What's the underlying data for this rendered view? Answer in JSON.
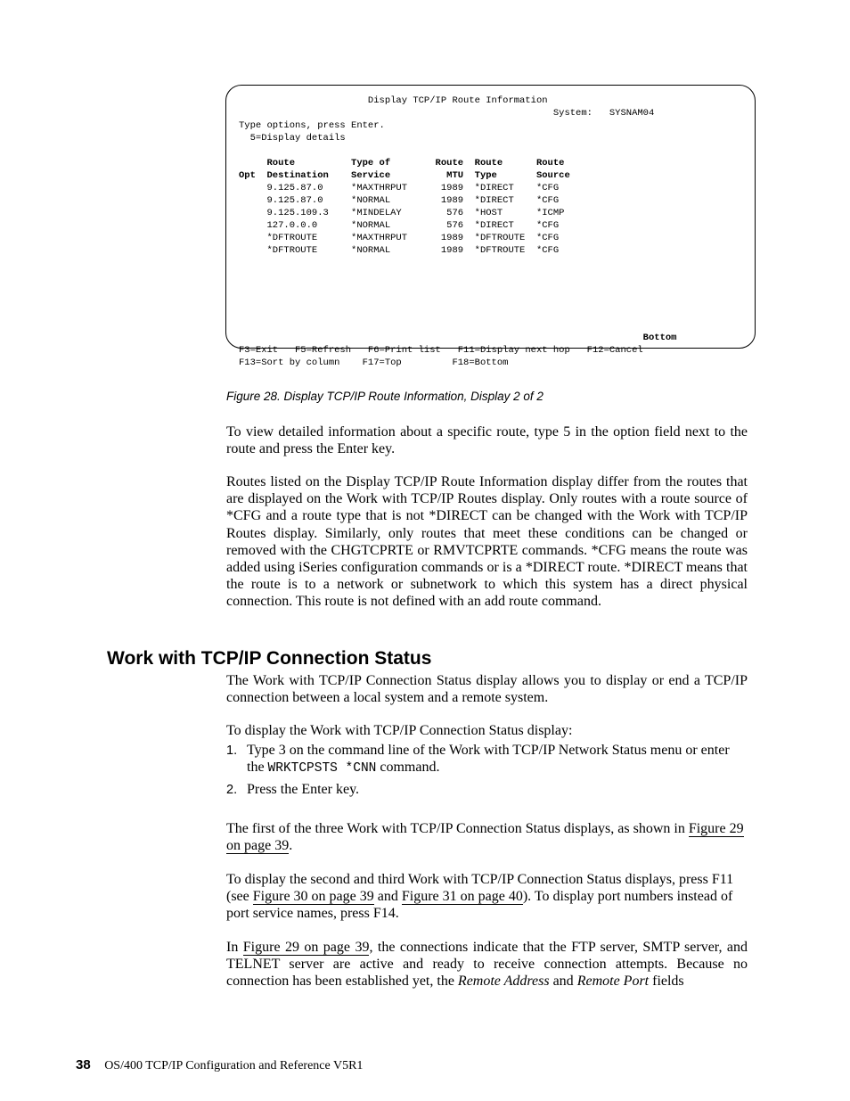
{
  "terminal": {
    "title": "Display TCP/IP Route Information",
    "system_label": "System:",
    "system_name": "SYSNAM04",
    "instruction1": "Type options, press Enter.",
    "instruction2": "  5=Display details",
    "headers": {
      "opt": "Opt",
      "route_dest1": "Route",
      "route_dest2": "Destination",
      "tos1": "Type of",
      "tos2": "Service",
      "mtu1": "Route",
      "mtu2": "MTU",
      "type1": "Route",
      "type2": "Type",
      "src1": "Route",
      "src2": "Source"
    },
    "rows": [
      {
        "dest": "9.125.87.0",
        "svc": "*MAXTHRPUT",
        "mtu": "1989",
        "type": "*DIRECT",
        "src": "*CFG"
      },
      {
        "dest": "9.125.87.0",
        "svc": "*NORMAL",
        "mtu": "1989",
        "type": "*DIRECT",
        "src": "*CFG"
      },
      {
        "dest": "9.125.109.3",
        "svc": "*MINDELAY",
        "mtu": "576",
        "type": "*HOST",
        "src": "*ICMP"
      },
      {
        "dest": "127.0.0.0",
        "svc": "*NORMAL",
        "mtu": "576",
        "type": "*DIRECT",
        "src": "*CFG"
      },
      {
        "dest": "*DFTROUTE",
        "svc": "*MAXTHRPUT",
        "mtu": "1989",
        "type": "*DFTROUTE",
        "src": "*CFG"
      },
      {
        "dest": "*DFTROUTE",
        "svc": "*NORMAL",
        "mtu": "1989",
        "type": "*DFTROUTE",
        "src": "*CFG"
      }
    ],
    "bottom_label": "Bottom",
    "fkeys_line1": "F3=Exit   F5=Refresh   F6=Print list   F11=Display next hop   F12=Cancel",
    "fkeys_line2": "F13=Sort by column    F17=Top         F18=Bottom"
  },
  "caption": "Figure 28. Display TCP/IP Route Information, Display 2 of 2",
  "para1": "To view detailed information about a specific route, type 5 in the option field next to the route and press the Enter key.",
  "para2": "Routes listed on the Display TCP/IP Route Information display differ from the routes that are displayed on the Work with TCP/IP Routes display. Only routes with a route source of *CFG and a route type that is not *DIRECT can be changed with the Work with TCP/IP Routes display. Similarly, only routes that meet these conditions can be changed or removed with the CHGTCPRTE or RMVTCPRTE commands. *CFG means the route was added using iSeries configuration commands or is a *DIRECT route. *DIRECT means that the route is to a network or subnetwork to which this system has a direct physical connection. This route is not defined with an add route command.",
  "section_title": "Work with TCP/IP Connection Status",
  "para3": "The Work with TCP/IP Connection Status display allows you to display or end a TCP/IP connection between a local system and a remote system.",
  "para4": "To display the Work with TCP/IP Connection Status display:",
  "ol": {
    "n1": "1.",
    "i1a": "Type 3 on the command line of the Work with TCP/IP Network Status menu or enter the ",
    "i1cmd": "WRKTCPSTS *CNN",
    "i1b": " command.",
    "n2": "2.",
    "i2": "Press the Enter key."
  },
  "para5a": "The first of the three Work with TCP/IP Connection Status displays, as shown in ",
  "link5": "Figure 29 on page 39",
  "para5b": ".",
  "para6a": "To display the second and third Work with TCP/IP Connection Status displays, press F11 (see ",
  "link6a": "Figure 30 on page 39",
  "para6b": " and ",
  "link6b": "Figure 31 on page 40",
  "para6c": "). To display port numbers instead of port service names, press F14.",
  "para7a": "In ",
  "link7": "Figure 29 on page 39",
  "para7b": ", the connections indicate that the FTP server, SMTP server, and TELNET server are active and ready to receive connection attempts. Because no connection has been established yet, the ",
  "para7i1": "Remote Address",
  "para7c": " and ",
  "para7i2": "Remote Port",
  "para7d": " fields",
  "footer_page": "38",
  "footer_text": "OS/400 TCP/IP Configuration and Reference V5R1"
}
